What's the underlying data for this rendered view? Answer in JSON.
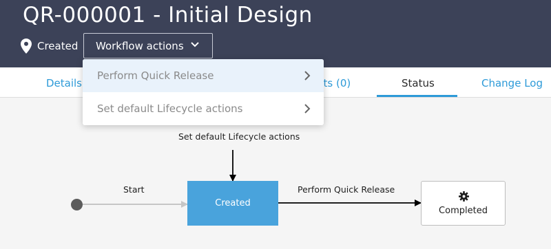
{
  "header": {
    "title": "QR-000001 - Initial Design",
    "state_label": "Created",
    "workflow_button_label": "Workflow actions"
  },
  "tabs": [
    {
      "label": "Details",
      "active": false
    },
    {
      "label": "nts (0)",
      "active": false
    },
    {
      "label": "Status",
      "active": true
    },
    {
      "label": "Change Log",
      "active": false
    }
  ],
  "dropdown": {
    "items": [
      {
        "label": "Perform Quick Release",
        "highlighted": true
      },
      {
        "label": "Set default Lifecycle actions",
        "highlighted": false
      }
    ]
  },
  "diagram": {
    "top_action_label": "Set default Lifecycle actions",
    "start_label": "Start",
    "transition_label": "Perform Quick Release",
    "node_created": "Created",
    "node_completed": "Completed",
    "colors": {
      "header_bg": "#3c4258",
      "accent": "#2d9ad8",
      "created_node": "#49a3dc"
    },
    "icons": {
      "state": "map-pin-icon",
      "completed": "gear-icon"
    }
  }
}
